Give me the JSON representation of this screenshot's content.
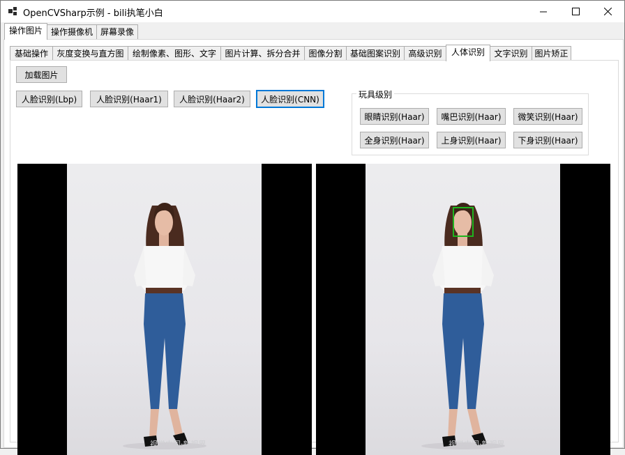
{
  "window": {
    "title": "OpenCVSharp示例 - bili执笔小白",
    "controls": [
      "minimize-icon",
      "maximize-icon",
      "close-icon"
    ]
  },
  "outer_tabs": [
    {
      "label": "操作图片",
      "active": true
    },
    {
      "label": "操作摄像机",
      "active": false
    },
    {
      "label": "屏幕录像",
      "active": false
    }
  ],
  "inner_tabs": [
    {
      "label": "基础操作",
      "active": false
    },
    {
      "label": "灰度变换与直方图",
      "active": false
    },
    {
      "label": "绘制像素、图形、文字",
      "active": false
    },
    {
      "label": "图片计算、拆分合并",
      "active": false
    },
    {
      "label": "图像分割",
      "active": false
    },
    {
      "label": "基础图案识别",
      "active": false
    },
    {
      "label": "高级识别",
      "active": false
    },
    {
      "label": "人体识别",
      "active": true
    },
    {
      "label": "文字识别",
      "active": false
    },
    {
      "label": "图片矫正",
      "active": false
    }
  ],
  "buttons": {
    "load_image": "加载图片",
    "face_lbp": "人脸识别(Lbp)",
    "face_haar1": "人脸识别(Haar1)",
    "face_haar2": "人脸识别(Haar2)",
    "face_cnn": "人脸识别(CNN)"
  },
  "toy_group": {
    "legend": "玩具级别",
    "buttons": {
      "eyes": "眼睛识别(Haar)",
      "mouth": "嘴巴识别(Haar)",
      "smile": "微笑识别(Haar)",
      "full_body": "全身识别(Haar)",
      "upper_body": "上身识别(Haar)",
      "lower_body": "下身识别(Haar)"
    }
  },
  "images": {
    "source_watermark": "视觉中国·新视界",
    "result_watermark": "视觉中国·新视界",
    "detection_color": "#1fb51f"
  },
  "colors": {
    "focus_border": "#0078d7",
    "button_face": "#e1e1e1",
    "tab_border": "#adadad"
  }
}
